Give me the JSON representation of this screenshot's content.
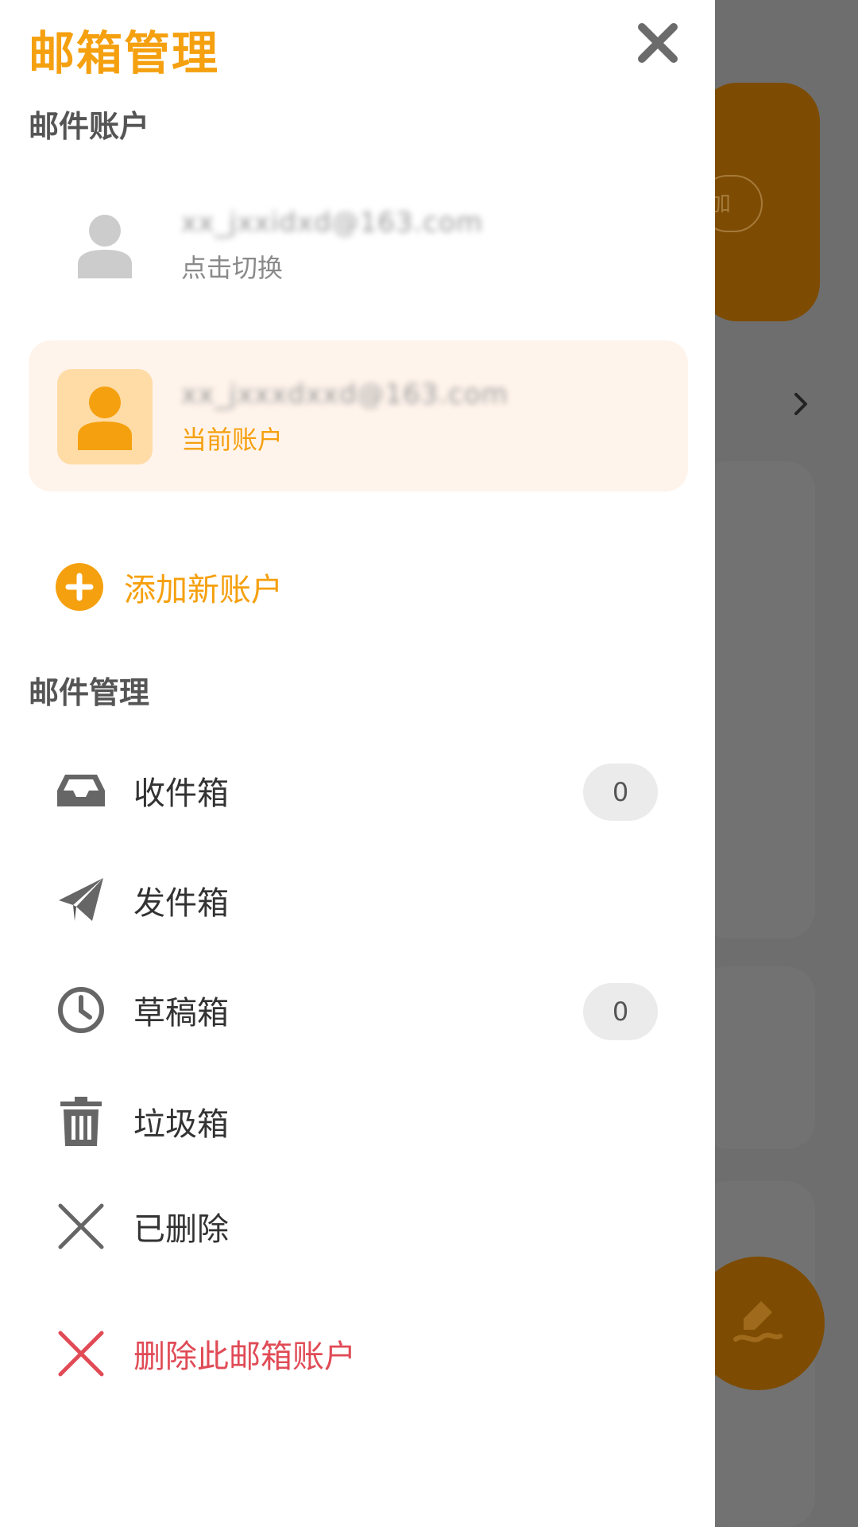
{
  "drawer": {
    "title": "邮箱管理",
    "close_icon": "close-icon"
  },
  "sections": {
    "accounts_label": "邮件账户",
    "mail_label": "邮件管理"
  },
  "accounts": [
    {
      "email": "xx_jxxidxd@163.com",
      "status": "点击切换",
      "icon": "user-icon",
      "color": "#cccccc"
    },
    {
      "email": "xx_jxxxdxxd@163.com",
      "status": "当前账户",
      "icon": "user-icon",
      "color": "#f5a00f"
    }
  ],
  "add_account": {
    "label": "添加新账户",
    "icon": "plus-circle-icon"
  },
  "menu": {
    "inbox": {
      "label": "收件箱",
      "count": "0",
      "icon": "inbox-icon"
    },
    "sent": {
      "label": "发件箱",
      "icon": "paper-plane-icon"
    },
    "drafts": {
      "label": "草稿箱",
      "count": "0",
      "icon": "clock-icon"
    },
    "trash": {
      "label": "垃圾箱",
      "icon": "trash-icon"
    },
    "deleted": {
      "label": "已删除",
      "icon": "x-icon"
    }
  },
  "delete_account": {
    "label": "删除此邮箱账户",
    "icon": "x-icon",
    "color": "#e04b56"
  },
  "background": {
    "pill_text": "加",
    "accent": "#7d4c02"
  },
  "colors": {
    "accent": "#f5a00f",
    "danger": "#e04b56",
    "current_account_bg": "#fff4ec"
  }
}
